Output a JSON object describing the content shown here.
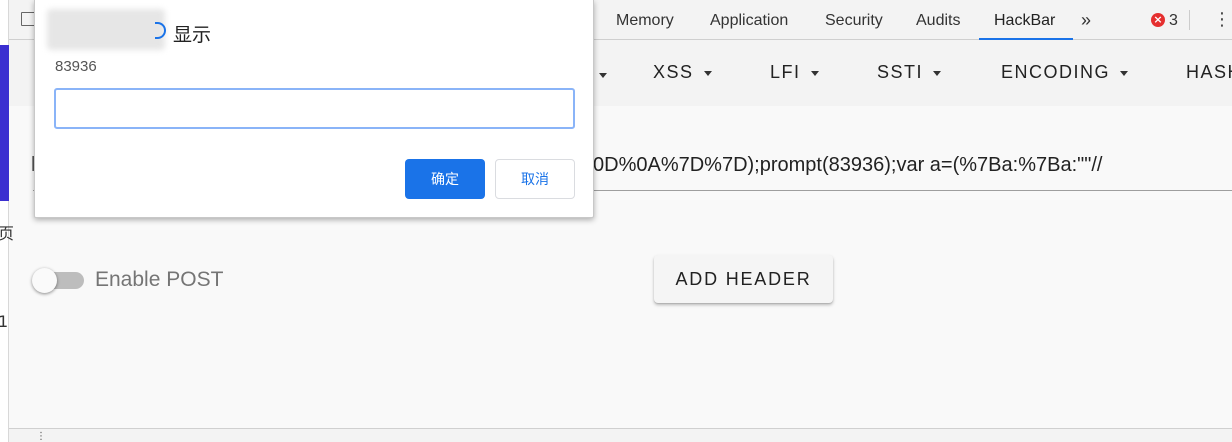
{
  "devtools": {
    "tabs": [
      {
        "label": "Memory"
      },
      {
        "label": "Application"
      },
      {
        "label": "Security"
      },
      {
        "label": "Audits"
      },
      {
        "label": "HackBar",
        "active": true
      }
    ],
    "more_tabs_glyph": "»",
    "error_icon_glyph": "×",
    "error_count": "3",
    "menu_glyph": "⋮"
  },
  "hackbar": {
    "menus": [
      "XSS",
      "LFI",
      "SSTI",
      "ENCODING",
      "HASH"
    ],
    "url_visible": "0D%0A%7D%7D);prompt(83936);var a=(%7Ba:%7Ba:\"\"//",
    "url_prefix_char": "l",
    "enable_post_label": "Enable POST",
    "enable_post_on": false,
    "add_header_label": "ADD HEADER"
  },
  "left_page": {
    "glyphs": [
      "页",
      "1"
    ]
  },
  "dialog": {
    "title_suffix": "显示",
    "message": "83936",
    "input_value": "",
    "ok_label": "确定",
    "cancel_label": "取消"
  },
  "colors": {
    "accent": "#1a73e8",
    "error": "#e52f2f",
    "page_accent": "#3b2fd0"
  },
  "icons": [
    "dock-icon",
    "chevron-double-right-icon",
    "error-icon",
    "kebab-menu-icon",
    "caret-down-icon"
  ]
}
